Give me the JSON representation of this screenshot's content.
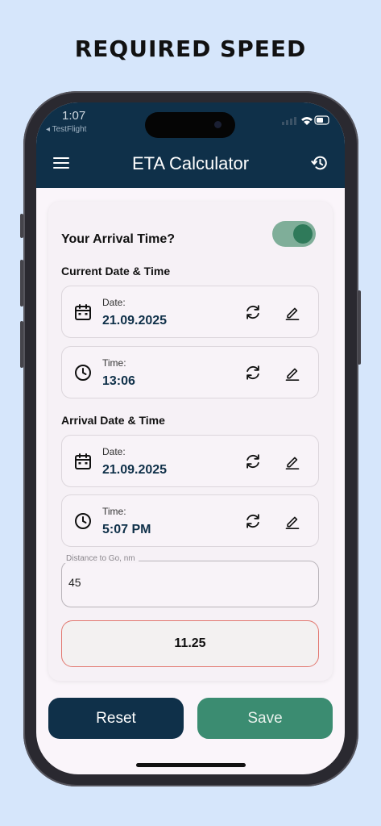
{
  "headline": "REQUIRED SPEED",
  "status": {
    "time": "1:07",
    "back_app": "◂ TestFlight"
  },
  "appbar": {
    "title": "ETA Calculator"
  },
  "arrival_toggle": {
    "label": "Your Arrival Time?",
    "on": true
  },
  "current": {
    "section_label": "Current Date & Time",
    "date": {
      "label": "Date:",
      "value": "21.09.2025"
    },
    "time": {
      "label": "Time:",
      "value": "13:06"
    }
  },
  "arrival": {
    "section_label": "Arrival Date & Time",
    "date": {
      "label": "Date:",
      "value": "21.09.2025"
    },
    "time": {
      "label": "Time:",
      "value": "5:07 PM"
    }
  },
  "distance": {
    "label": "Distance to Go, nm",
    "value": "45"
  },
  "result": {
    "value": "11.25"
  },
  "buttons": {
    "reset": "Reset",
    "save": "Save"
  },
  "colors": {
    "primary": "#0f3049",
    "accent": "#3b8c71",
    "result_border": "#e27870",
    "background": "#d6e6fb"
  }
}
